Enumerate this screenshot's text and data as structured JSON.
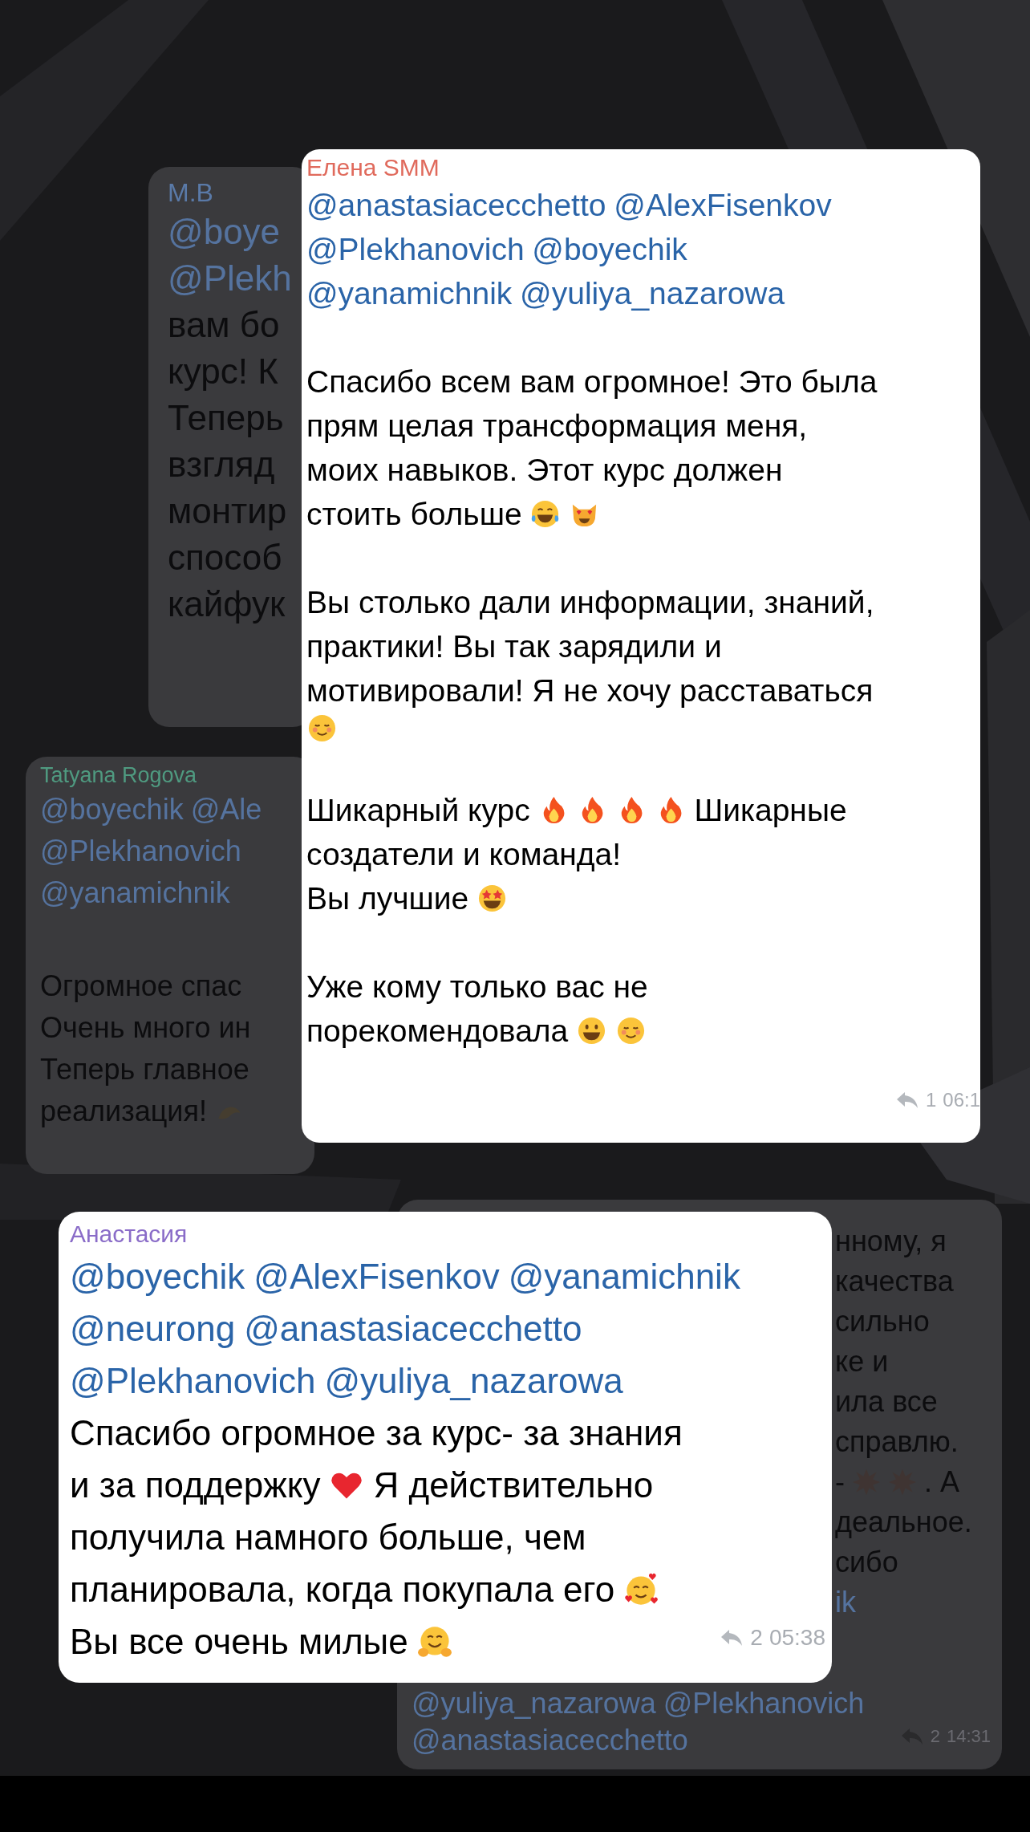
{
  "messages": [
    {
      "sender": "M.B",
      "color": "#5a7aa8",
      "dimmed": true,
      "paragraphs": [
        {
          "lines": [
            {
              "segments": [
                {
                  "kind": "mention",
                  "text": "@boye"
                }
              ]
            },
            {
              "segments": [
                {
                  "kind": "mention",
                  "text": "@Plekh"
                }
              ]
            },
            {
              "segments": [
                {
                  "kind": "text",
                  "text": "вам бо"
                }
              ]
            },
            {
              "segments": [
                {
                  "kind": "text",
                  "text": "курс! К"
                }
              ]
            },
            {
              "segments": [
                {
                  "kind": "text",
                  "text": "Теперь"
                }
              ]
            },
            {
              "segments": [
                {
                  "kind": "text",
                  "text": "взгляд"
                }
              ]
            },
            {
              "segments": [
                {
                  "kind": "text",
                  "text": "монтир"
                }
              ]
            },
            {
              "segments": [
                {
                  "kind": "text",
                  "text": "способ"
                }
              ]
            },
            {
              "segments": [
                {
                  "kind": "text",
                  "text": "кайфук"
                }
              ]
            }
          ]
        }
      ]
    },
    {
      "sender": "Tatyana Rogova",
      "color": "#4f9a80",
      "dimmed": true,
      "paragraphs": [
        {
          "lines": [
            {
              "segments": [
                {
                  "kind": "mention",
                  "text": "@boyechik"
                },
                {
                  "kind": "mention",
                  "text": "@Ale"
                }
              ]
            },
            {
              "segments": [
                {
                  "kind": "mention",
                  "text": "@Plekhanovich"
                }
              ]
            },
            {
              "segments": [
                {
                  "kind": "mention",
                  "text": "@yanamichnik"
                }
              ]
            }
          ]
        },
        {
          "lines": [
            {
              "segments": [
                {
                  "kind": "text",
                  "text": "Огромное спас"
                }
              ]
            },
            {
              "segments": [
                {
                  "kind": "text",
                  "text": "Очень много ин"
                }
              ]
            },
            {
              "segments": [
                {
                  "kind": "text",
                  "text": "Теперь главное"
                }
              ]
            },
            {
              "segments": [
                {
                  "kind": "text",
                  "text": "реализация!"
                },
                {
                  "kind": "hands"
                }
              ]
            }
          ]
        }
      ]
    },
    {
      "sender": "Елена SMM",
      "color": "#e06a5c",
      "dimmed": false,
      "footer": {
        "replies": "1",
        "time": "06:1"
      },
      "paragraphs": [
        {
          "lines": [
            {
              "segments": [
                {
                  "kind": "mention",
                  "text": "@anastasiacecchetto"
                },
                {
                  "kind": "mention",
                  "text": "@AlexFisenkov"
                }
              ]
            },
            {
              "segments": [
                {
                  "kind": "mention",
                  "text": "@Plekhanovich"
                },
                {
                  "kind": "mention",
                  "text": "@boyechik"
                }
              ]
            },
            {
              "segments": [
                {
                  "kind": "mention",
                  "text": "@yanamichnik"
                },
                {
                  "kind": "mention",
                  "text": "@yuliya_nazarowa"
                }
              ]
            }
          ]
        },
        {
          "lines": [
            {
              "segments": [
                {
                  "kind": "text",
                  "text": "Спасибо всем вам огромное! Это была"
                }
              ]
            },
            {
              "segments": [
                {
                  "kind": "text",
                  "text": "прям целая трансформация меня,"
                }
              ]
            },
            {
              "segments": [
                {
                  "kind": "text",
                  "text": "моих навыков. Этот курс должен"
                }
              ]
            },
            {
              "segments": [
                {
                  "kind": "text",
                  "text": "стоить больше"
                },
                {
                  "kind": "laugh"
                },
                {
                  "kind": "cat"
                }
              ]
            }
          ]
        },
        {
          "lines": [
            {
              "segments": [
                {
                  "kind": "text",
                  "text": "Вы столько дали информации, знаний,"
                }
              ]
            },
            {
              "segments": [
                {
                  "kind": "text",
                  "text": "практики! Вы так зарядили и"
                }
              ]
            },
            {
              "segments": [
                {
                  "kind": "text",
                  "text": "мотивировали! Я не хочу расставаться"
                }
              ]
            },
            {
              "segments": [
                {
                  "kind": "smile"
                }
              ]
            }
          ]
        },
        {
          "lines": [
            {
              "segments": [
                {
                  "kind": "text",
                  "text": "Шикарный курс"
                },
                {
                  "kind": "fire"
                },
                {
                  "kind": "fire"
                },
                {
                  "kind": "fire"
                },
                {
                  "kind": "fire"
                },
                {
                  "kind": "text",
                  "text": "Шикарные"
                }
              ]
            },
            {
              "segments": [
                {
                  "kind": "text",
                  "text": "создатели и команда!"
                }
              ]
            },
            {
              "segments": [
                {
                  "kind": "text",
                  "text": "Вы лучшие"
                },
                {
                  "kind": "star"
                }
              ]
            }
          ]
        },
        {
          "lines": [
            {
              "segments": [
                {
                  "kind": "text",
                  "text": "Уже кому только вас не"
                }
              ]
            },
            {
              "segments": [
                {
                  "kind": "text",
                  "text": "порекомендовала"
                },
                {
                  "kind": "grin"
                },
                {
                  "kind": "smile"
                }
              ]
            }
          ]
        }
      ]
    },
    {
      "dimmed": true,
      "footer": {
        "replies": "2",
        "time": "14:31"
      },
      "paragraphs": [
        {
          "lines": [
            {
              "segments": [
                {
                  "kind": "text",
                  "text": "нному, я"
                }
              ]
            },
            {
              "segments": [
                {
                  "kind": "text",
                  "text": "качества"
                }
              ]
            },
            {
              "segments": [
                {
                  "kind": "text",
                  "text": "сильно"
                }
              ]
            },
            {
              "segments": [
                {
                  "kind": "text",
                  "text": "ке и"
                }
              ]
            },
            {
              "segments": [
                {
                  "kind": "text",
                  "text": "ила все"
                }
              ]
            },
            {
              "segments": [
                {
                  "kind": "text",
                  "text": "справлю."
                }
              ]
            },
            {
              "segments": [
                {
                  "kind": "text",
                  "text": "-"
                },
                {
                  "kind": "burst"
                },
                {
                  "kind": "burst"
                },
                {
                  "kind": "text",
                  "text": ". А"
                }
              ]
            },
            {
              "segments": [
                {
                  "kind": "text",
                  "text": "деальное."
                }
              ]
            },
            {
              "segments": [
                {
                  "kind": "text",
                  "text": "сибо"
                }
              ]
            },
            {
              "segments": [
                {
                  "kind": "mention",
                  "text": "ik"
                }
              ]
            }
          ]
        },
        {
          "lines": [
            {
              "segments": [
                {
                  "kind": "mention",
                  "text": "@yuliya_nazarowa"
                },
                {
                  "kind": "mention",
                  "text": "@Plekhanovich"
                }
              ]
            },
            {
              "segments": [
                {
                  "kind": "mention",
                  "text": "@anastasiacecchetto"
                }
              ]
            }
          ]
        }
      ]
    },
    {
      "sender": "Анастасия",
      "color": "#8a6cc8",
      "dimmed": false,
      "footer": {
        "replies": "2",
        "time": "05:38"
      },
      "paragraphs": [
        {
          "lines": [
            {
              "segments": [
                {
                  "kind": "mention",
                  "text": "@boyechik"
                },
                {
                  "kind": "mention",
                  "text": "@AlexFisenkov"
                },
                {
                  "kind": "mention",
                  "text": "@yanamichnik"
                }
              ]
            },
            {
              "segments": [
                {
                  "kind": "mention",
                  "text": "@neurong"
                },
                {
                  "kind": "mention",
                  "text": "@anastasiacecchetto"
                }
              ]
            },
            {
              "segments": [
                {
                  "kind": "mention",
                  "text": "@Plekhanovich"
                },
                {
                  "kind": "mention",
                  "text": "@yuliya_nazarowa"
                }
              ]
            },
            {
              "segments": [
                {
                  "kind": "text",
                  "text": "Спасибо огромное за курс- за знания"
                }
              ]
            },
            {
              "segments": [
                {
                  "kind": "text",
                  "text": "и за поддержку"
                },
                {
                  "kind": "heart"
                },
                {
                  "kind": "text",
                  "text": "Я действительно"
                }
              ]
            },
            {
              "segments": [
                {
                  "kind": "text",
                  "text": "получила намного больше, чем"
                }
              ]
            },
            {
              "segments": [
                {
                  "kind": "text",
                  "text": "планировала, когда покупала его"
                },
                {
                  "kind": "hearts"
                }
              ]
            },
            {
              "segments": [
                {
                  "kind": "text",
                  "text": "Вы все очень милые"
                },
                {
                  "kind": "hug"
                }
              ]
            }
          ]
        }
      ]
    }
  ]
}
